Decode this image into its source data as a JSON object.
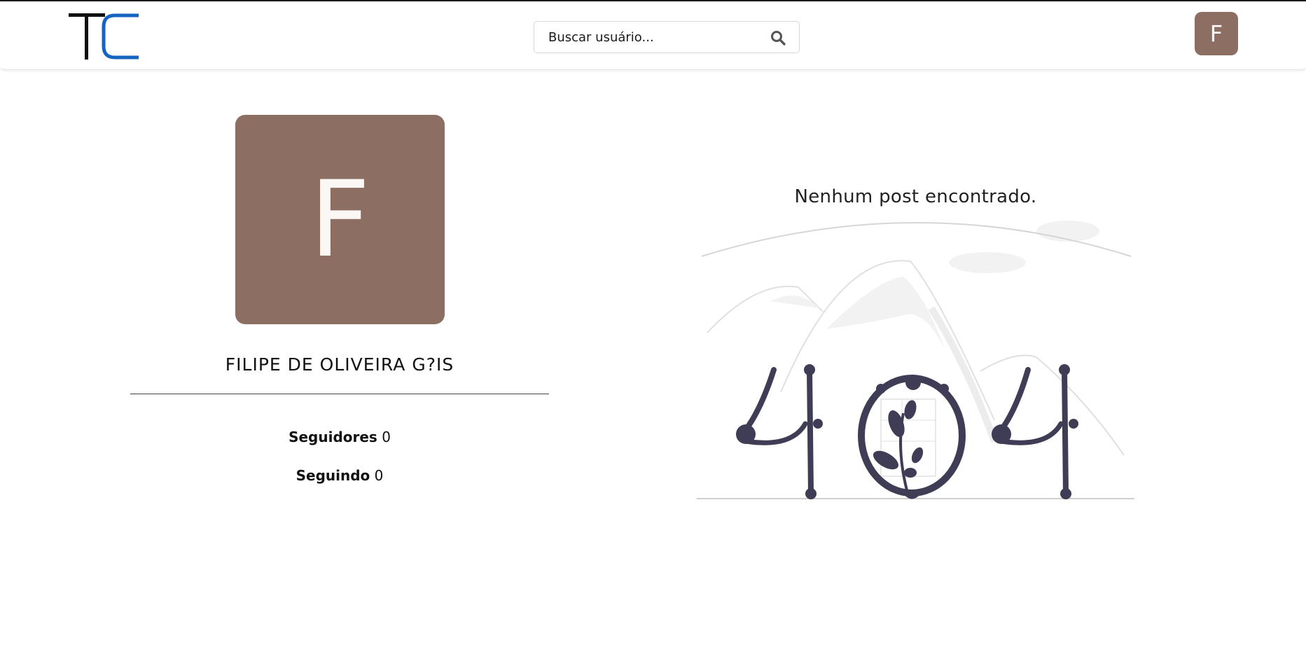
{
  "header": {
    "logo_text": "TC",
    "search": {
      "placeholder": "Buscar usuário...",
      "value": "",
      "icon": "search-icon"
    },
    "user_avatar_initial": "F"
  },
  "profile": {
    "avatar_initial": "F",
    "name": "FILIPE DE OLIVEIRA G?IS",
    "followers_label": "Seguidores",
    "followers_count": "0",
    "following_label": "Seguindo",
    "following_count": "0"
  },
  "posts": {
    "empty_message": "Nenhum post encontrado.",
    "illustration": "404-illustration"
  },
  "colors": {
    "avatar_bg": "#8d6e63",
    "logo_black": "#111111",
    "logo_blue": "#1565c0",
    "illustration_dark": "#3f3d56",
    "illustration_light": "#f2f2f2"
  }
}
